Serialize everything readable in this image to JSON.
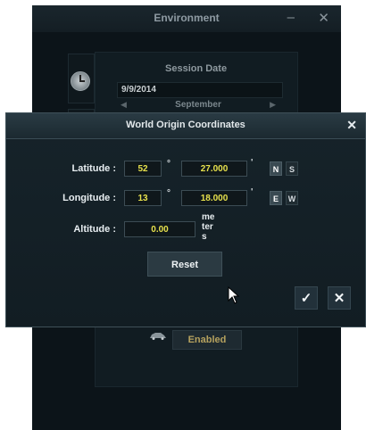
{
  "environment": {
    "title": "Environment",
    "minimize_label": "–",
    "close_label": "✕",
    "session_label": "Session Date",
    "session_date": "9/9/2014",
    "month_prev": "◀",
    "month_name": "September",
    "month_next": "▶",
    "enabled_label": "Enabled",
    "icons": [
      "clock-icon",
      "vehicle-icon"
    ]
  },
  "dialog": {
    "title": "World Origin Coordinates",
    "close_label": "✕",
    "latitude": {
      "label": "Latitude :",
      "degrees": "52",
      "degree_mark": "°",
      "minutes": "27.000",
      "minute_mark": "'",
      "dir_a": "N",
      "dir_b": "S"
    },
    "longitude": {
      "label": "Longitude :",
      "degrees": "13",
      "degree_mark": "°",
      "minutes": "18.000",
      "minute_mark": "'",
      "dir_a": "E",
      "dir_b": "W"
    },
    "altitude": {
      "label": "Altitude :",
      "value": "0.00",
      "unit": "meters"
    },
    "reset_label": "Reset",
    "ok_label": "✓",
    "cancel_label": "✕"
  },
  "colors": {
    "value_yellow": "#e6e04c",
    "enabled_text": "#b5a15e",
    "background": "#0c1419"
  }
}
